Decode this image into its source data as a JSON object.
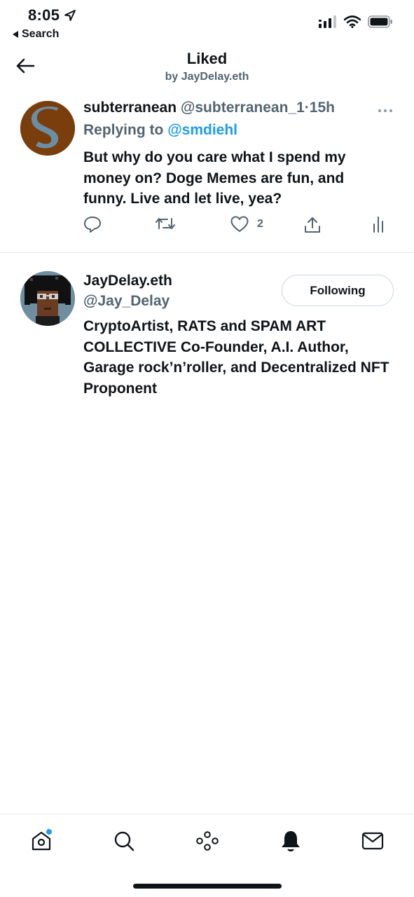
{
  "status_bar": {
    "time": "8:05",
    "back_app_label": "Search"
  },
  "header": {
    "title": "Liked",
    "subtitle": "by JayDelay.eth"
  },
  "tweet": {
    "author_name": "subterranean",
    "author_handle": "@subterranean_1",
    "separator": "·",
    "time_ago": "15h",
    "reply_prefix": "Replying to",
    "reply_target": "@smdiehl",
    "text": "But why do you care what I spend my money on? Doge Memes are fun, and funny. Live and let live, yea?",
    "like_count": "2"
  },
  "user": {
    "name": "JayDelay.eth",
    "handle": "@Jay_Delay",
    "follow_label": "Following",
    "bio": "CryptoArtist, RATS and SPAM ART COLLECTIVE Co-Founder, A.I. Author, Garage rock’n’roller, and Decentralized NFT Proponent"
  },
  "tabs": [
    "home-icon",
    "search-icon",
    "spaces-icon",
    "notifications-icon",
    "messages-icon"
  ],
  "colors": {
    "accent": "#1d9bf0",
    "text_primary": "#0f1419",
    "text_secondary": "#536471",
    "divider": "#e6e9eb"
  }
}
